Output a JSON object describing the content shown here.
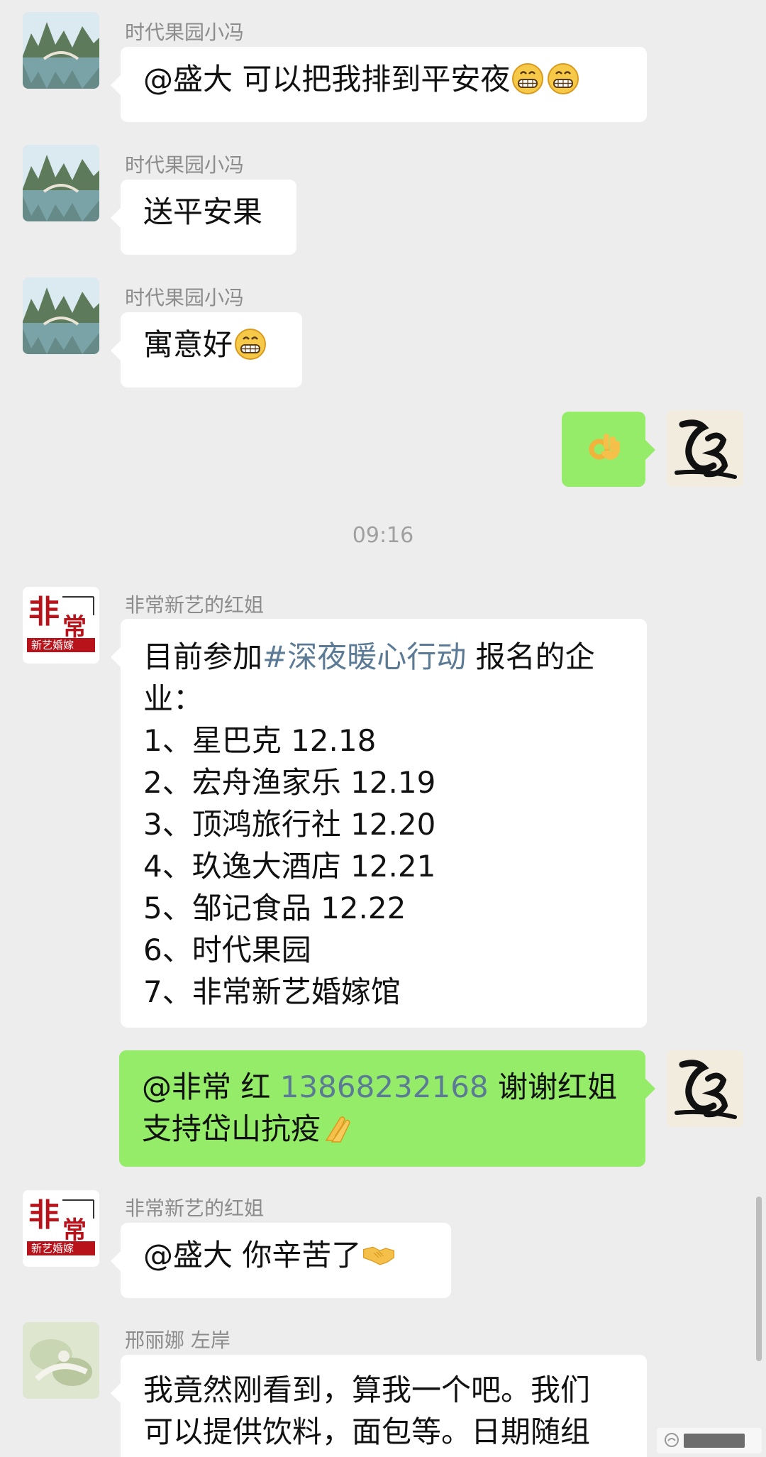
{
  "senders": {
    "fruit": "时代果园小冯",
    "hongjie": "非常新艺的红姐",
    "xing": "邢丽娜 左岸"
  },
  "avatars": {
    "hongjie_line1": "非",
    "hongjie_line2": "常",
    "hongjie_line3": "新艺婚嫁"
  },
  "messages": {
    "m1": {
      "text": "@盛大  可以把我排到平安夜"
    },
    "m2": {
      "text": "送平安果"
    },
    "m3": {
      "text": "寓意好"
    },
    "m5": {
      "lead": "目前参加",
      "hashtag": "#深夜暖心行动",
      "tail": " 报名的企",
      "lines": [
        "业：",
        "1、星巴克 12.18",
        "2、宏舟渔家乐 12.19",
        "3、顶鸿旅行社  12.20",
        "4、玖逸大酒店 12.21",
        "5、邹记食品 12.22",
        "6、时代果园",
        "7、非常新艺婚嫁馆"
      ]
    },
    "m6": {
      "prefix": "@非常 红 ",
      "phone": "13868232168",
      "suffix": "  谢谢红姐",
      "line2": "支持岱山抗疫"
    },
    "m7": {
      "text": "@盛大  你辛苦了"
    },
    "m8": {
      "line1": "我竟然刚看到，算我一个吧。我们",
      "line2": "可以提供饮料，面包等。日期随组"
    }
  },
  "timestamp": "09:16",
  "colors": {
    "background": "#ededed",
    "incoming_bubble": "#ffffff",
    "outgoing_bubble": "#95ec69",
    "link": "#5b7a95",
    "sender_name": "#8c8c8c"
  },
  "icons": [
    "grin-emoji",
    "ok-hand-emoji",
    "folded-hands-emoji",
    "handshake-emoji",
    "calligraphy-avatar",
    "landscape-avatar"
  ]
}
